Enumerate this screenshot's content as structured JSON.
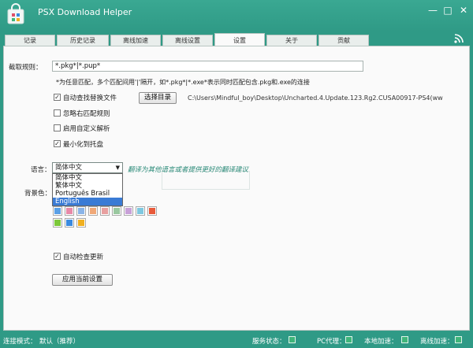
{
  "window": {
    "title": "PSX Download Helper"
  },
  "tabs": [
    {
      "label": "记录"
    },
    {
      "label": "历史记录"
    },
    {
      "label": "离线加速"
    },
    {
      "label": "离线设置"
    },
    {
      "label": "设置"
    },
    {
      "label": "关于"
    },
    {
      "label": "贡献"
    }
  ],
  "settings": {
    "capture_rule_label": "截取规则：",
    "capture_rule_value": "*.pkg*|*.pup*",
    "capture_rule_hint": "*为任意匹配，多个匹配间用'|'隔开，如*.pkg*|*.exe*表示同时匹配包含.pkg和.exe的连接",
    "auto_find_label": "自动查找替换文件",
    "auto_find_checked": true,
    "choose_dir_label": "选择目录",
    "dir_path": "C:\\Users\\Mindful_boy\\Desktop\\Uncharted.4.Update.123.Rg2.CUSA00917-PS4(ww",
    "ignore_left_label": "忽略右匹配规则",
    "ignore_left_checked": false,
    "custom_parse_label": "启用自定义解析",
    "custom_parse_checked": false,
    "minimize_tray_label": "最小化到托盘",
    "minimize_tray_checked": true,
    "language_label": "语言：",
    "language_selected": "简体中文",
    "language_options": [
      "简体中文",
      "繁体中文",
      "Português Brasil",
      "English"
    ],
    "language_hint": "翻译为其他语言或者提供更好的翻译建议",
    "bg_color_label": "背景色：",
    "swatch_colors_row1": [
      "#5aa0e6",
      "#e88aa8",
      "#8ab4e8",
      "#f0a878",
      "#e8a0a0",
      "#9ac8a0",
      "#c8a0d8",
      "#7ec8e0",
      "#e85a3a"
    ],
    "swatch_colors_row2": [
      "#7cc83a",
      "#3a8ae0",
      "#f0b020"
    ],
    "auto_update_label": "自动检查更新",
    "auto_update_checked": true,
    "apply_label": "应用当前设置"
  },
  "status": {
    "conn_mode_label": "连接模式：",
    "conn_mode_value": "默认（推荐）",
    "service_label": "服务状态：",
    "pc_proxy_label": "PC代理：",
    "local_accel_label": "本地加速：",
    "offline_accel_label": "离线加速："
  }
}
